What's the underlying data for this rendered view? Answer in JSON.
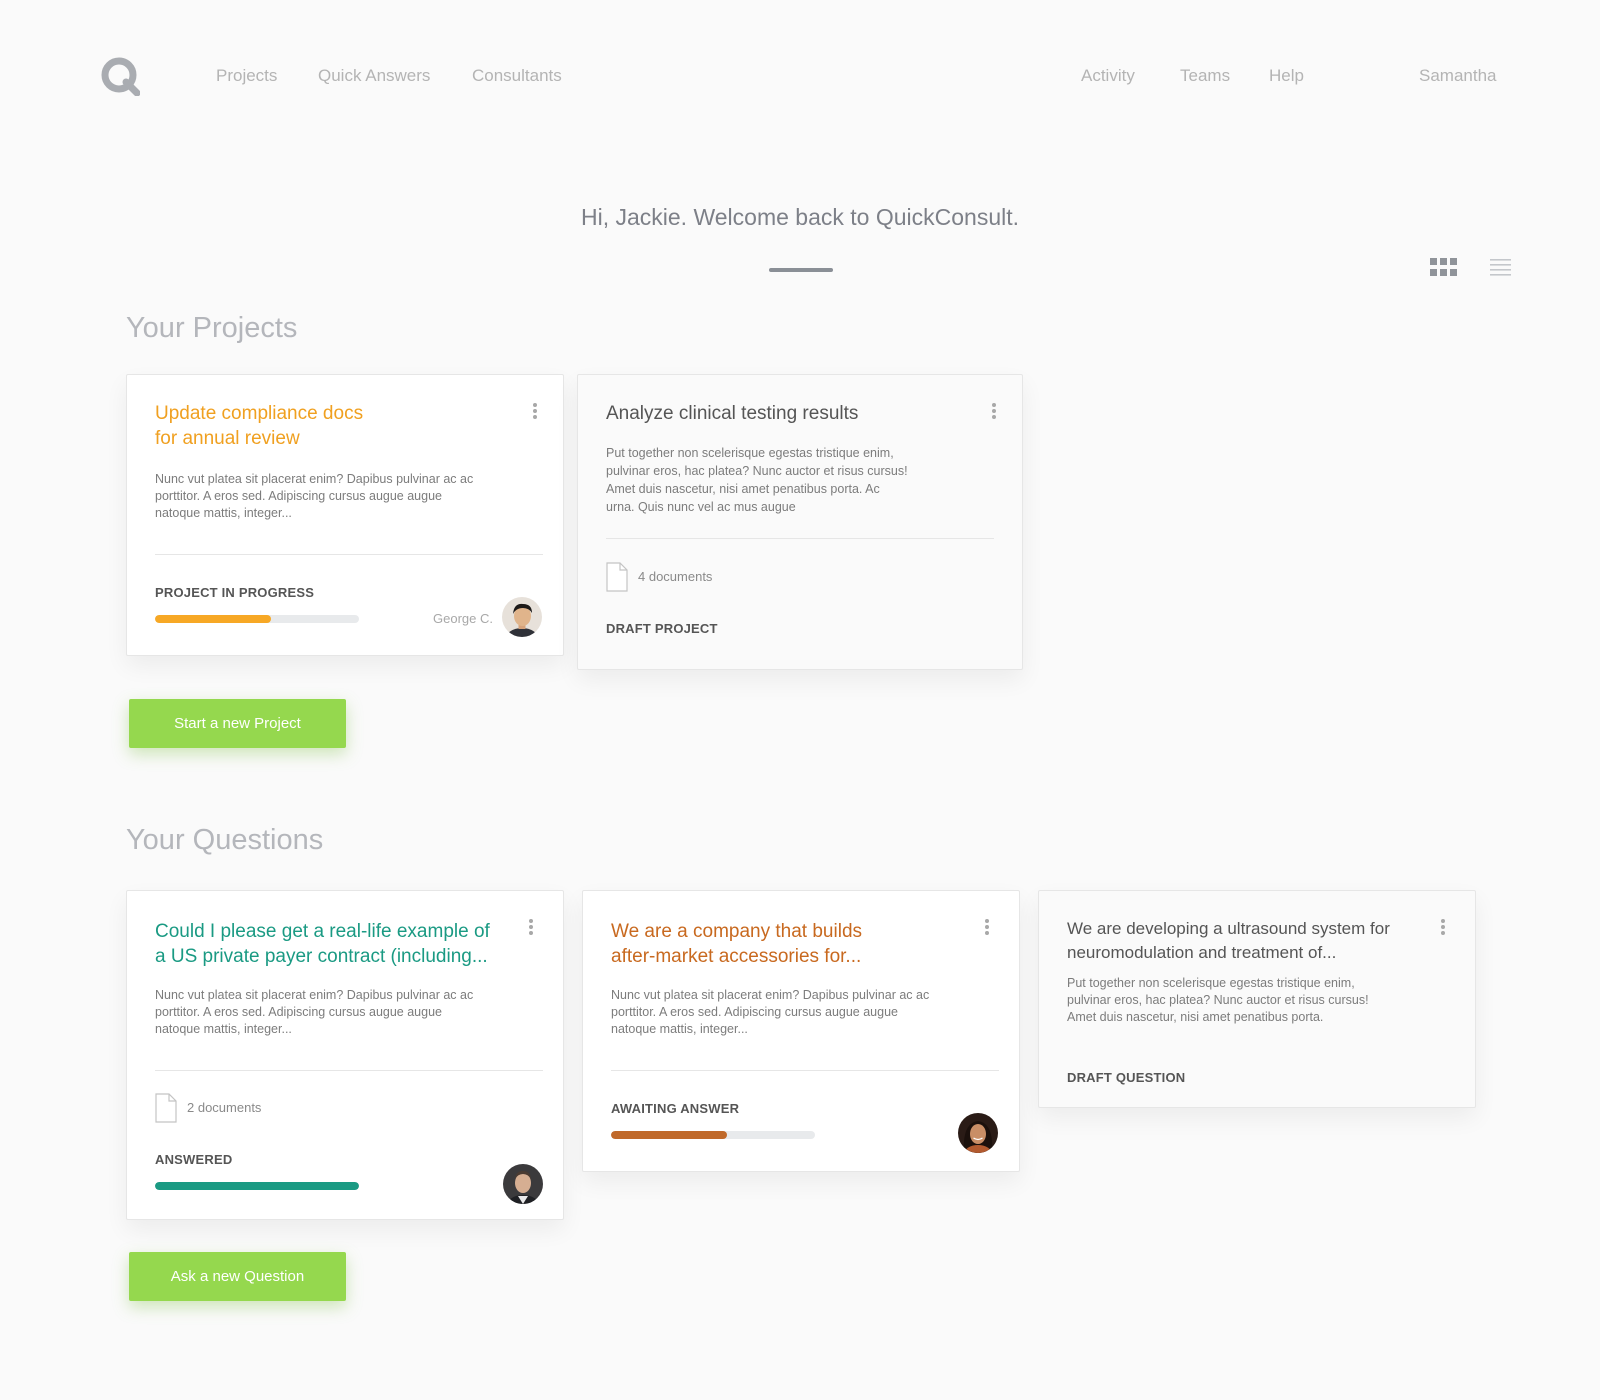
{
  "nav": {
    "logo_icon": "quickconsult-q-logo",
    "left_links": [
      "Projects",
      "Quick Answers",
      "Consultants"
    ],
    "right_links": [
      "Activity",
      "Teams",
      "Help"
    ],
    "user_name": "Samantha"
  },
  "welcome": {
    "message": "Hi, Jackie. Welcome back to QuickConsult."
  },
  "view_toggle": {
    "grid_icon": "grid-view-icon",
    "list_icon": "list-view-icon",
    "active": "grid"
  },
  "projects": {
    "section_title": "Your Projects",
    "cards": [
      {
        "title_line1": "Update compliance docs",
        "title_line2": "for annual review",
        "title_color": "#f0a020",
        "desc_line1": "Nunc vut platea sit placerat enim? Dapibus pulvinar ac ac",
        "desc_line2": "porttitor. A eros sed. Adipiscing cursus augue augue",
        "desc_line3": "natoque mattis, integer...",
        "status": "PROJECT IN PROGRESS",
        "progress": 0.57,
        "progress_color": "#f7a825",
        "assignee": "George C."
      },
      {
        "title": "Analyze clinical testing results",
        "title_color": "#555555",
        "desc_line1": "Put together non scelerisque egestas tristique enim,",
        "desc_line2": "pulvinar eros, hac platea? Nunc auctor et risus cursus!",
        "desc_line3": "Amet duis nascetur, nisi amet penatibus porta. Ac",
        "desc_line4": "urna. Quis nunc vel ac mus augue",
        "documents": "4 documents",
        "status": "DRAFT PROJECT"
      }
    ],
    "new_button": "Start a new Project"
  },
  "questions": {
    "section_title": "Your Questions",
    "cards": [
      {
        "title_line1": "Could I please get a real-life example of",
        "title_line2": "a US private payer contract (including...",
        "title_color": "#1a9a83",
        "desc_line1": "Nunc vut platea sit placerat enim? Dapibus pulvinar ac ac",
        "desc_line2": "porttitor. A eros sed. Adipiscing cursus augue augue",
        "desc_line3": "natoque mattis, integer...",
        "documents": "2 documents",
        "status": "ANSWERED",
        "progress": 1.0,
        "progress_color": "#1a9a83"
      },
      {
        "title_line1": "We are a company that builds",
        "title_line2": "after-market accessories for...",
        "title_color": "#c8691f",
        "desc_line1": "Nunc vut platea sit placerat enim? Dapibus pulvinar ac ac",
        "desc_line2": "porttitor. A eros sed. Adipiscing cursus augue augue",
        "desc_line3": "natoque mattis, integer...",
        "status": "AWAITING ANSWER",
        "progress": 0.57,
        "progress_color": "#c0692a"
      },
      {
        "title_line1": "We are developing a ultrasound system for",
        "title_line2": "neuromodulation and treatment of...",
        "title_color": "#555555",
        "desc_line1": "Put together non scelerisque egestas tristique enim,",
        "desc_line2": "pulvinar eros, hac platea? Nunc auctor et risus cursus!",
        "desc_line3": "Amet duis nascetur, nisi amet penatibus porta.",
        "status": "DRAFT QUESTION"
      }
    ],
    "new_button": "Ask a new Question"
  }
}
